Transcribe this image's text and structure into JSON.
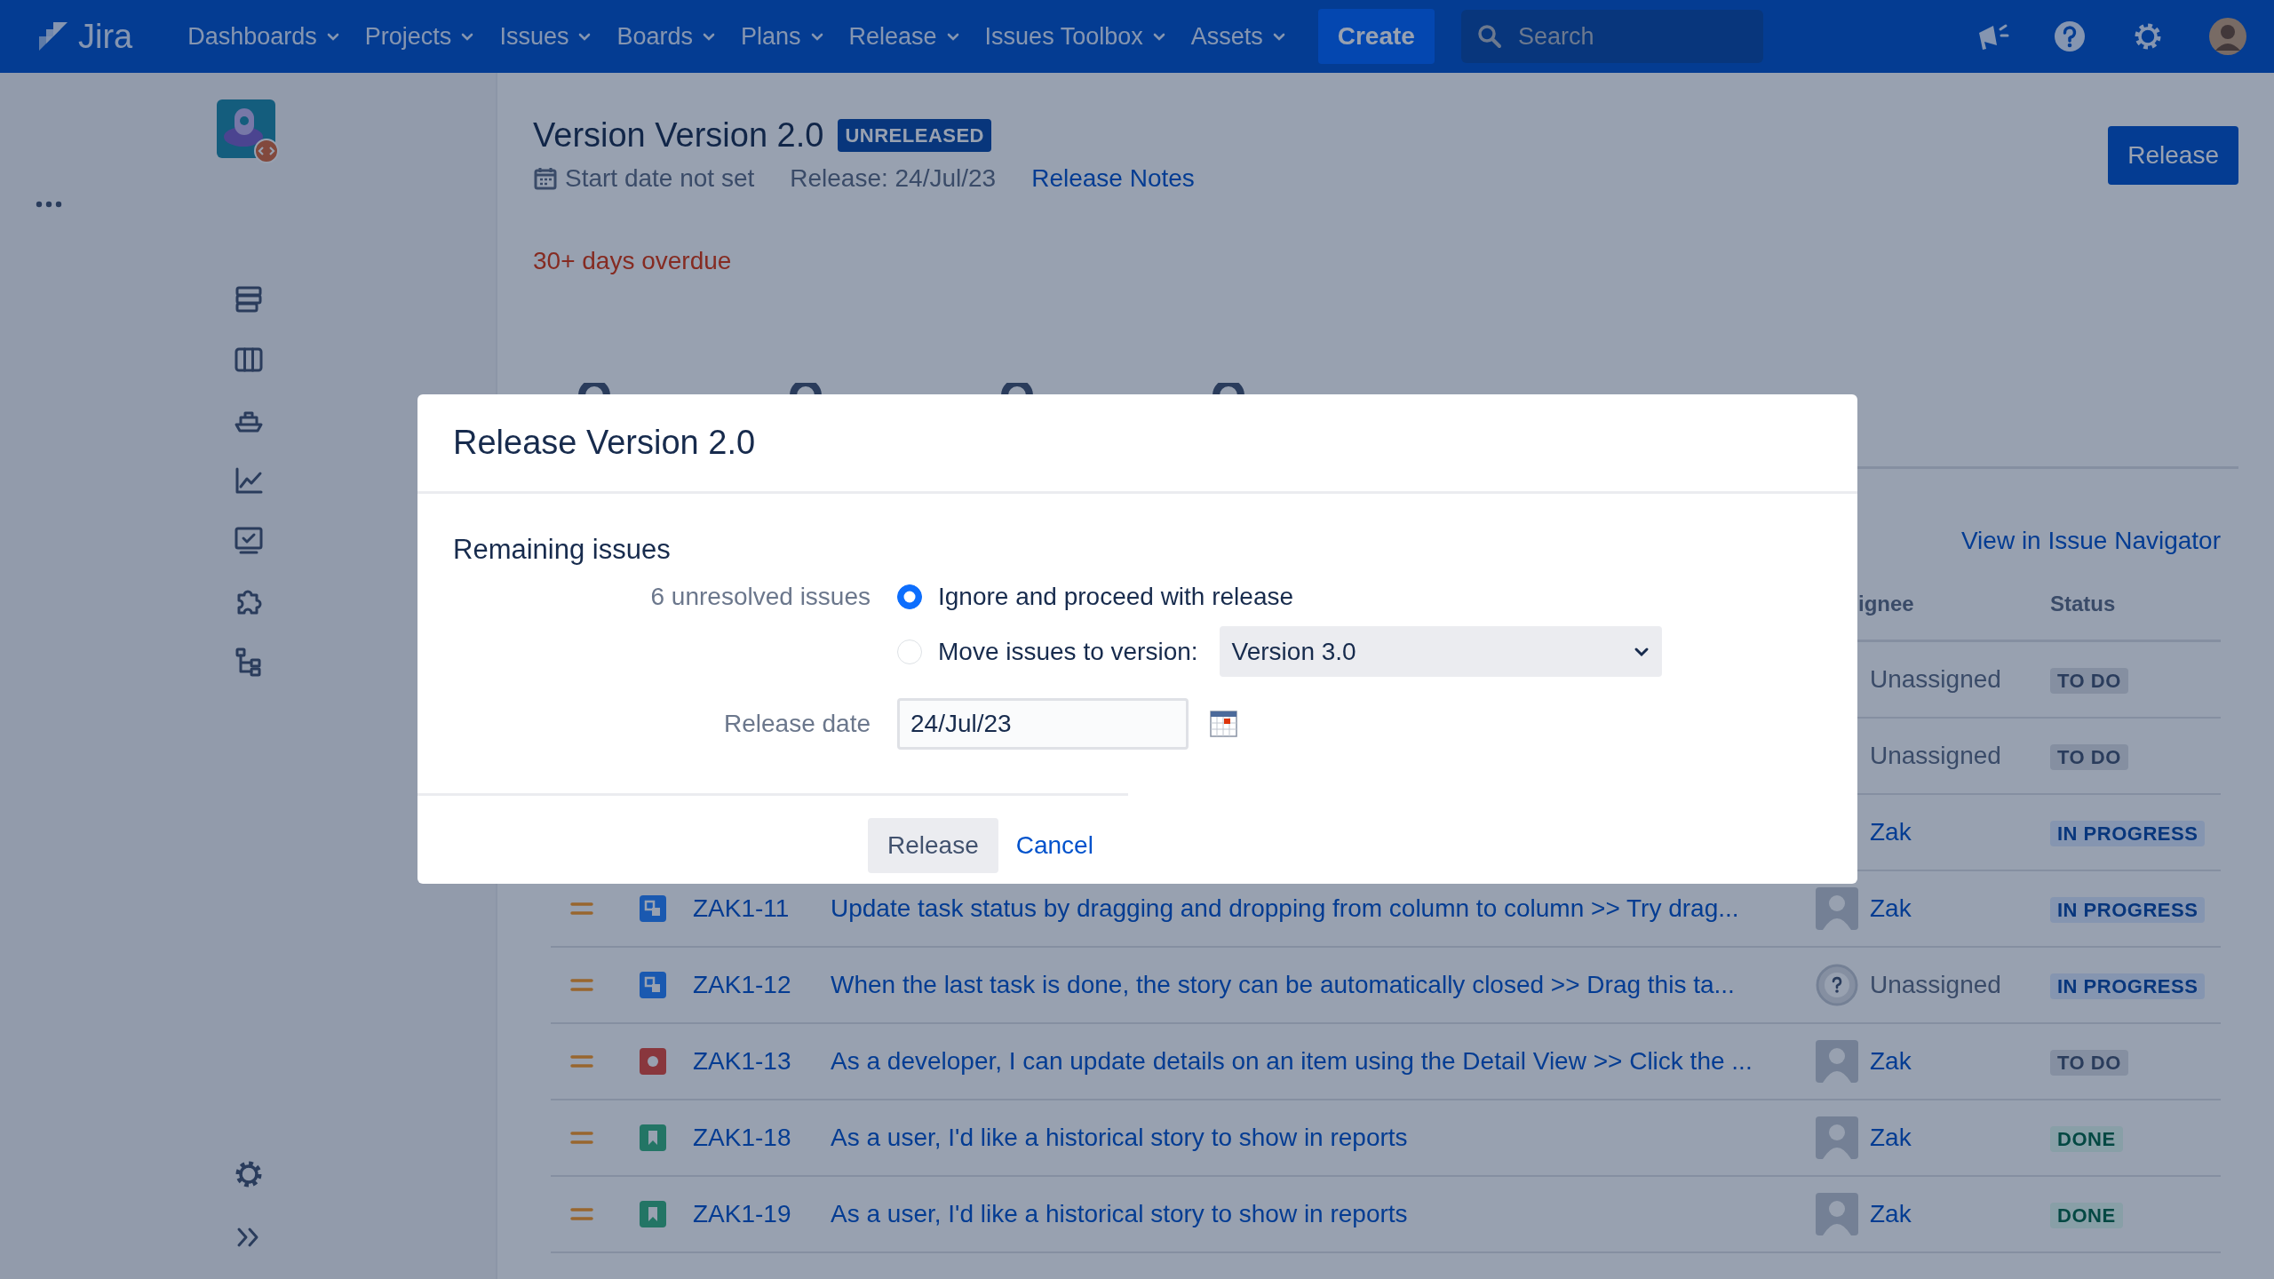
{
  "topnav": {
    "logo": "Jira",
    "menus": [
      {
        "label": "Dashboards"
      },
      {
        "label": "Projects"
      },
      {
        "label": "Issues"
      },
      {
        "label": "Boards"
      },
      {
        "label": "Plans"
      },
      {
        "label": "Release"
      },
      {
        "label": "Issues Toolbox"
      },
      {
        "label": "Assets"
      }
    ],
    "create": "Create",
    "search": {
      "placeholder": "Search"
    }
  },
  "version": {
    "title": "Version Version 2.0",
    "badge": "UNRELEASED",
    "start_date": "Start date not set",
    "release_date": "Release: 24/Jul/23",
    "release_notes": "Release Notes",
    "release_button": "Release",
    "overdue": "30+ days overdue"
  },
  "issue_navigator_link": "View in Issue Navigator",
  "table": {
    "columns": [
      "ignee",
      "Status"
    ],
    "rows": [
      {
        "assignee": {
          "name": "Unassigned",
          "kind": "unassigned"
        },
        "status": {
          "label": "TO DO",
          "kind": "todo"
        }
      },
      {
        "assignee": {
          "name": "Unassigned",
          "kind": "unassigned"
        },
        "status": {
          "label": "TO DO",
          "kind": "todo"
        }
      },
      {
        "assignee": {
          "name": "Zak",
          "kind": "user"
        },
        "status": {
          "label": "IN PROGRESS",
          "kind": "inprogress"
        }
      },
      {
        "issue_type": {
          "kind": "subtask"
        },
        "key": "ZAK1-11",
        "summary": "Update task status by dragging and dropping from column to column >> Try drag...",
        "assignee": {
          "name": "Zak",
          "kind": "user"
        },
        "status": {
          "label": "IN PROGRESS",
          "kind": "inprogress"
        }
      },
      {
        "issue_type": {
          "kind": "subtask"
        },
        "key": "ZAK1-12",
        "summary": "When the last task is done, the story can be automatically closed >> Drag this ta...",
        "assignee": {
          "name": "Unassigned",
          "kind": "unassigned"
        },
        "status": {
          "label": "IN PROGRESS",
          "kind": "inprogress"
        }
      },
      {
        "issue_type": {
          "kind": "bug"
        },
        "key": "ZAK1-13",
        "summary": "As a developer, I can update details on an item using the Detail View >> Click the ...",
        "assignee": {
          "name": "Zak",
          "kind": "user"
        },
        "status": {
          "label": "TO DO",
          "kind": "todo"
        }
      },
      {
        "issue_type": {
          "kind": "story"
        },
        "key": "ZAK1-18",
        "summary": "As a user, I'd like a historical story to show in reports",
        "assignee": {
          "name": "Zak",
          "kind": "user"
        },
        "status": {
          "label": "DONE",
          "kind": "done"
        }
      },
      {
        "issue_type": {
          "kind": "story"
        },
        "key": "ZAK1-19",
        "summary": "As a user, I'd like a historical story to show in reports",
        "assignee": {
          "name": "Zak",
          "kind": "user"
        },
        "status": {
          "label": "DONE",
          "kind": "done"
        }
      }
    ]
  },
  "dialog": {
    "title": "Release Version 2.0",
    "section": "Remaining issues",
    "unresolved_label": "6 unresolved issues",
    "options": [
      {
        "label": "Ignore and proceed with release",
        "selected": true
      },
      {
        "label": "Move issues to version:",
        "selected": false
      }
    ],
    "version_select": "Version 3.0",
    "date_label": "Release date",
    "date_value": "24/Jul/23",
    "buttons": [
      {
        "label": "Release",
        "kind": "button"
      },
      {
        "label": "Cancel",
        "kind": "link"
      }
    ]
  }
}
